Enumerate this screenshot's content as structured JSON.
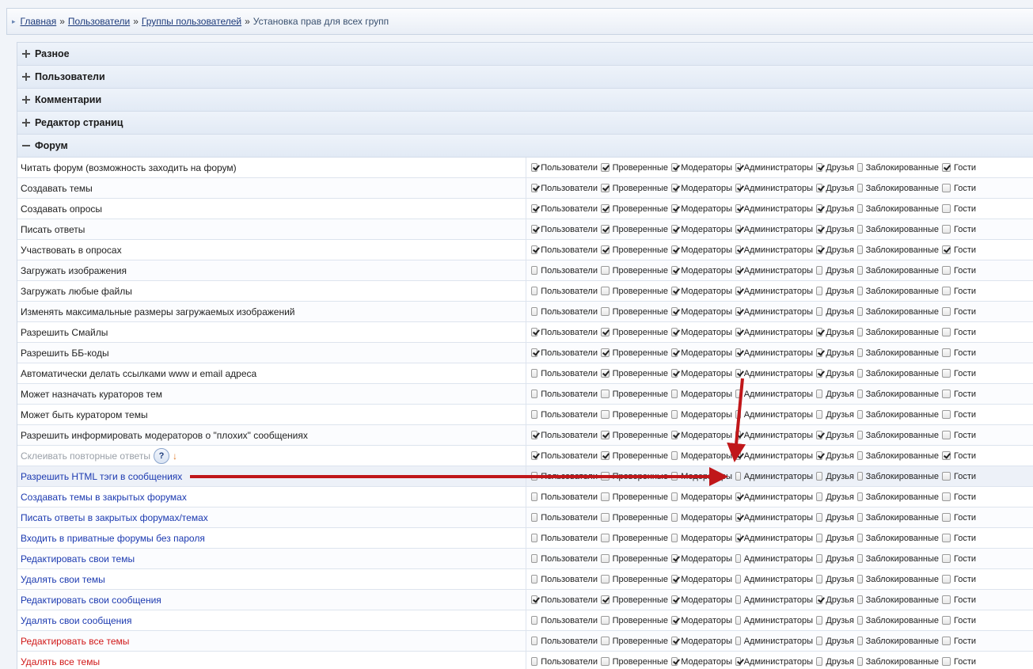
{
  "breadcrumb": {
    "items": [
      "Главная",
      "Пользователи",
      "Группы пользователей"
    ],
    "separator": "»",
    "current": "Установка прав для всех групп"
  },
  "sections": [
    {
      "title": "Разное",
      "expanded": false
    },
    {
      "title": "Пользователи",
      "expanded": false
    },
    {
      "title": "Комментарии",
      "expanded": false
    },
    {
      "title": "Редактор страниц",
      "expanded": false
    },
    {
      "title": "Форум",
      "expanded": true
    }
  ],
  "groups": [
    "Пользователи",
    "Проверенные",
    "Модераторы",
    "Администраторы",
    "Друзья",
    "Заблокированные",
    "Гости"
  ],
  "help_icon_label": "?",
  "rows": [
    {
      "label": "Читать форум (возможность заходить на форум)",
      "color": "default",
      "checks": [
        1,
        1,
        1,
        1,
        1,
        0,
        1
      ]
    },
    {
      "label": "Создавать темы",
      "color": "default",
      "checks": [
        1,
        1,
        1,
        1,
        1,
        0,
        0
      ]
    },
    {
      "label": "Создавать опросы",
      "color": "default",
      "checks": [
        1,
        1,
        1,
        1,
        1,
        0,
        0
      ]
    },
    {
      "label": "Писать ответы",
      "color": "default",
      "checks": [
        1,
        1,
        1,
        1,
        1,
        0,
        0
      ]
    },
    {
      "label": "Участвовать в опросах",
      "color": "default",
      "checks": [
        1,
        1,
        1,
        1,
        1,
        0,
        1
      ]
    },
    {
      "label": "Загружать изображения",
      "color": "default",
      "checks": [
        0,
        0,
        1,
        1,
        0,
        0,
        0
      ]
    },
    {
      "label": "Загружать любые файлы",
      "color": "default",
      "checks": [
        0,
        0,
        1,
        1,
        0,
        0,
        0
      ]
    },
    {
      "label": "Изменять максимальные размеры загружаемых изображений",
      "color": "default",
      "checks": [
        0,
        0,
        1,
        1,
        0,
        0,
        0
      ]
    },
    {
      "label": "Разрешить Смайлы",
      "color": "default",
      "checks": [
        1,
        1,
        1,
        1,
        1,
        0,
        0
      ]
    },
    {
      "label": "Разрешить ББ-коды",
      "color": "default",
      "checks": [
        1,
        1,
        1,
        1,
        1,
        0,
        0
      ]
    },
    {
      "label": "Автоматически делать ссылками www и email адреса",
      "color": "default",
      "checks": [
        0,
        1,
        1,
        1,
        1,
        0,
        0
      ]
    },
    {
      "label": "Может назначать кураторов тем",
      "color": "default",
      "checks": [
        0,
        0,
        0,
        0,
        0,
        0,
        0
      ]
    },
    {
      "label": "Может быть куратором темы",
      "color": "default",
      "checks": [
        0,
        0,
        0,
        0,
        0,
        0,
        0
      ]
    },
    {
      "label": "Разрешить информировать модераторов о \"плохих\" сообщениях",
      "color": "default",
      "checks": [
        1,
        1,
        1,
        1,
        1,
        0,
        0
      ]
    },
    {
      "label": "Склеивать повторные ответы",
      "color": "gray",
      "help": true,
      "checks": [
        1,
        1,
        0,
        1,
        1,
        0,
        1
      ]
    },
    {
      "label": "Разрешить HTML тэги в сообщениях",
      "color": "blue",
      "checks": [
        0,
        0,
        0,
        0,
        0,
        0,
        0
      ],
      "highlight": true
    },
    {
      "label": "Создавать темы в закрытых форумах",
      "color": "blue",
      "checks": [
        0,
        0,
        0,
        1,
        0,
        0,
        0
      ]
    },
    {
      "label": "Писать ответы в закрытых форумах/темах",
      "color": "blue",
      "checks": [
        0,
        0,
        0,
        1,
        0,
        0,
        0
      ]
    },
    {
      "label": "Входить в приватные форумы без пароля",
      "color": "blue",
      "checks": [
        0,
        0,
        0,
        1,
        0,
        0,
        0
      ]
    },
    {
      "label": "Редактировать свои темы",
      "color": "blue",
      "checks": [
        0,
        0,
        1,
        0,
        0,
        0,
        0
      ]
    },
    {
      "label": "Удалять свои темы",
      "color": "blue",
      "checks": [
        0,
        0,
        1,
        0,
        0,
        0,
        0
      ]
    },
    {
      "label": "Редактировать свои сообщения",
      "color": "blue",
      "checks": [
        1,
        1,
        1,
        0,
        1,
        0,
        0
      ]
    },
    {
      "label": "Удалять свои сообщения",
      "color": "blue",
      "checks": [
        0,
        0,
        1,
        0,
        0,
        0,
        0
      ]
    },
    {
      "label": "Редактировать все темы",
      "color": "red",
      "checks": [
        0,
        0,
        1,
        0,
        0,
        0,
        0
      ]
    },
    {
      "label": "Удалять все темы",
      "color": "red",
      "checks": [
        0,
        0,
        1,
        1,
        0,
        0,
        0
      ]
    }
  ],
  "colors": {
    "annotation_arrow": "#c0171a",
    "label_blue": "#1c3ab0",
    "label_red": "#d01818",
    "label_gray": "#9aa0a8"
  }
}
